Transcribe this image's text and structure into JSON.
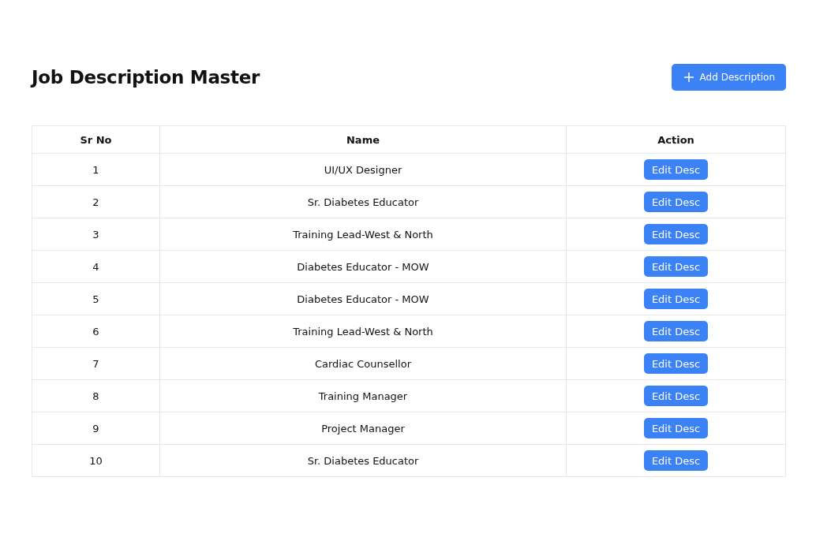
{
  "page": {
    "title": "Job Description Master",
    "add_button": {
      "label": "Add Description"
    }
  },
  "table": {
    "columns": [
      "Sr No",
      "Name",
      "Action"
    ],
    "rows": [
      {
        "sr_no": "1",
        "name": "UI/UX Designer",
        "action": "Edit Desc"
      },
      {
        "sr_no": "2",
        "name": "Sr. Diabetes Educator",
        "action": "Edit Desc"
      },
      {
        "sr_no": "3",
        "name": "Training Lead-West & North",
        "action": "Edit Desc"
      },
      {
        "sr_no": "4",
        "name": "Diabetes Educator - MOW",
        "action": "Edit Desc"
      },
      {
        "sr_no": "5",
        "name": "Diabetes Educator - MOW",
        "action": "Edit Desc"
      },
      {
        "sr_no": "6",
        "name": "Training Lead-West & North",
        "action": "Edit Desc"
      },
      {
        "sr_no": "7",
        "name": "Cardiac Counsellor",
        "action": "Edit Desc"
      },
      {
        "sr_no": "8",
        "name": "Training Manager",
        "action": "Edit Desc"
      },
      {
        "sr_no": "9",
        "name": "Project Manager",
        "action": "Edit Desc"
      },
      {
        "sr_no": "10",
        "name": "Sr. Diabetes Educator",
        "action": "Edit Desc"
      }
    ]
  }
}
